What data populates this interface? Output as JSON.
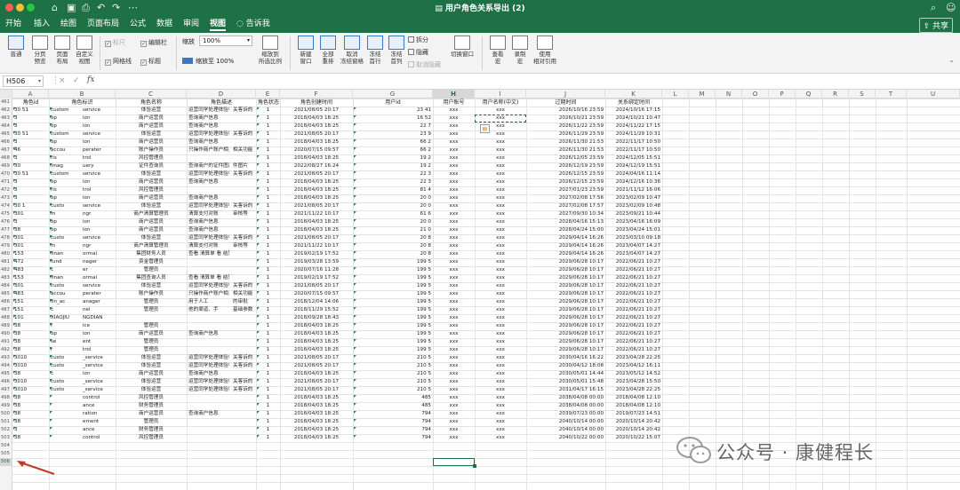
{
  "window": {
    "title": "用户角色关系导出 (2)",
    "controls": [
      "close",
      "minimize",
      "maximize"
    ],
    "quick_access": [
      "home-icon",
      "save-icon",
      "print-icon",
      "undo-icon",
      "redo-icon",
      "more-icon"
    ],
    "search_icon": "search-icon",
    "settings_icon": "profile-icon"
  },
  "tabs": [
    "开始",
    "插入",
    "绘图",
    "页面布局",
    "公式",
    "数据",
    "审阅",
    "视图",
    "告诉我"
  ],
  "active_tab": "视图",
  "share_label": "共享",
  "ribbon": {
    "view_buttons": [
      {
        "label": "普通",
        "icon": "normal-view-icon"
      },
      {
        "label": "分页\n预览",
        "icon": "page-break-icon"
      },
      {
        "label": "页面\n布局",
        "icon": "page-layout-icon"
      },
      {
        "label": "自定义\n视图",
        "icon": "custom-view-icon"
      }
    ],
    "checkboxes": [
      {
        "label": "标尺",
        "checked": true,
        "disabled": true
      },
      {
        "label": "编辑栏",
        "checked": true,
        "disabled": false
      },
      {
        "label": "网格线",
        "checked": true,
        "disabled": false
      },
      {
        "label": "标题",
        "checked": true,
        "disabled": false
      }
    ],
    "zoom_label": "缩放",
    "zoom_value": "100%",
    "zoom_100_label": "缩放至 100%",
    "zoom_selection_label": "缩放到\n所选比例",
    "window_buttons": [
      {
        "label": "新建\n窗口",
        "icon": "new-window-icon"
      },
      {
        "label": "全部\n重排",
        "icon": "arrange-all-icon"
      },
      {
        "label": "取消\n冻结窗格",
        "icon": "freeze-panes-icon"
      },
      {
        "label": "冻结\n首行",
        "icon": "freeze-row-icon"
      },
      {
        "label": "冻结\n首列",
        "icon": "freeze-col-icon"
      }
    ],
    "split_items": [
      {
        "label": "拆分",
        "disabled": false
      },
      {
        "label": "隐藏",
        "disabled": false
      },
      {
        "label": "取消隐藏",
        "disabled": true
      }
    ],
    "switch_window_label": "切换窗口",
    "macro_buttons": [
      {
        "label": "查看\n宏",
        "icon": "macro-view-icon"
      },
      {
        "label": "录制\n宏",
        "icon": "macro-record-icon"
      },
      {
        "label": "使用\n相对引用",
        "icon": "relative-ref-icon"
      }
    ]
  },
  "formula_bar": {
    "name_box": "H506",
    "cancel_icon": "×",
    "enter_icon": "✓",
    "fx": "fx",
    "value": ""
  },
  "columns": [
    "A",
    "B",
    "C",
    "D",
    "E",
    "F",
    "G",
    "H",
    "I",
    "J",
    "K",
    "L",
    "M",
    "N",
    "O",
    "P",
    "Q",
    "R",
    "S",
    "T",
    "U"
  ],
  "selected_column": "H",
  "header_row": {
    "number": "461",
    "cells": [
      "角色id",
      "角色标识",
      "角色名称",
      "角色描述",
      "角色状态",
      "角色创建时间",
      "用户id",
      "用户账号",
      "用户名称(中文)",
      "过期时间",
      "关系绑定时间"
    ]
  },
  "rows": [
    {
      "n": "462",
      "a": "30 51",
      "b": "custom",
      "b2": "service",
      "c": "体验运营",
      "d": "运营同学处理体验相关",
      "d2": "关客诉的",
      "e": "1",
      "f": "2021/08/05 20:17",
      "g": "23 41",
      "h": "xxx",
      "i": "xxx",
      "j": "2026/10/16 23:59",
      "k": "2024/10/16 17:15"
    },
    {
      "n": "463",
      "a": "3",
      "b": "op",
      "b2": "ion",
      "c": "商户运营员",
      "d": "查询商户信息",
      "d2": "",
      "e": "1",
      "f": "2018/04/03 18:25",
      "g": "16 52",
      "h": "xxx",
      "i": "xxx",
      "j": "2026/10/21 23:59",
      "k": "2024/10/21 10:47"
    },
    {
      "n": "464",
      "a": "3",
      "b": "op",
      "b2": "ion",
      "c": "商户运营员",
      "d": "查询商户信息",
      "d2": "",
      "e": "1",
      "f": "2018/04/03 18:25",
      "g": "22 7",
      "h": "xxx",
      "i": "xxx",
      "j": "2026/11/22 23:59",
      "k": "2024/11/22 17:15"
    },
    {
      "n": "465",
      "a": "30 51",
      "b": "custom",
      "b2": "service",
      "c": "体验运营",
      "d": "运营同学处理体验相关",
      "d2": "关客诉的",
      "e": "1",
      "f": "2021/08/05 20:17",
      "g": "23 9",
      "h": "xxx",
      "i": "xxx",
      "j": "2026/11/29 23:59",
      "k": "2024/11/29 10:31"
    },
    {
      "n": "466",
      "a": "3",
      "b": "op",
      "b2": "ion",
      "c": "商户运营员",
      "d": "查询商户信息",
      "d2": "",
      "e": "1",
      "f": "2018/04/03 18:25",
      "g": "66 2",
      "h": "xxx",
      "i": "xxx",
      "j": "2026/11/30 21:53",
      "k": "2022/11/17 10:50"
    },
    {
      "n": "467",
      "a": "46",
      "b": "accou",
      "b2": "perater",
      "c": "账户操作员",
      "d": "只操作商户账户相关功能",
      "d2": "相关功能",
      "e": "1",
      "f": "2020/07/15 09:57",
      "g": "66 2",
      "h": "xxx",
      "i": "xxx",
      "j": "2026/11/30 21:53",
      "k": "2022/11/17 10:50"
    },
    {
      "n": "468",
      "a": "3",
      "b": "ris",
      "b2": "trol",
      "c": "风控管理员",
      "d": "",
      "d2": "",
      "e": "1",
      "f": "2018/04/03 18:25",
      "g": "19 2",
      "h": "xxx",
      "i": "xxx",
      "j": "2026/12/05 23:59",
      "k": "2024/12/05 15:51"
    },
    {
      "n": "469",
      "a": "30",
      "b": "imag",
      "b2": "uery",
      "c": "证件查询员",
      "d": "查询商户的证件图片",
      "d2": "件图片",
      "e": "1",
      "f": "2022/08/27 16:24",
      "g": "19 2",
      "h": "xxx",
      "i": "xxx",
      "j": "2026/12/19 23:59",
      "k": "2024/12/19 15:51"
    },
    {
      "n": "470",
      "a": "30 51",
      "b": "custom",
      "b2": "service",
      "c": "体验运营",
      "d": "运营同学处理体验相关",
      "d2": "关客诉的",
      "e": "1",
      "f": "2021/08/05 20:17",
      "g": "22 3",
      "h": "xxx",
      "i": "xxx",
      "j": "2026/12/15 23:59",
      "k": "2024/04/16 11:14"
    },
    {
      "n": "471",
      "a": "3",
      "b": "op",
      "b2": "ion",
      "c": "商户运营员",
      "d": "查询商户信息",
      "d2": "",
      "e": "1",
      "f": "2018/04/03 18:25",
      "g": "22 3",
      "h": "xxx",
      "i": "xxx",
      "j": "2026/12/15 23:59",
      "k": "2024/12/16 10:36"
    },
    {
      "n": "472",
      "a": "3",
      "b": "ris",
      "b2": "trol",
      "c": "风控管理员",
      "d": "",
      "d2": "",
      "e": "1",
      "f": "2018/04/03 18:25",
      "g": "81 4",
      "h": "xxx",
      "i": "xxx",
      "j": "2027/01/23 23:59",
      "k": "2021/11/12 16:06"
    },
    {
      "n": "473",
      "a": "3",
      "b": "op",
      "b2": "ion",
      "c": "商户运营员",
      "d": "查询商户信息",
      "d2": "",
      "e": "1",
      "f": "2018/04/03 18:25",
      "g": "20 0",
      "h": "xxx",
      "i": "xxx",
      "j": "2027/02/08 17:56",
      "k": "2023/02/09 10:47"
    },
    {
      "n": "474",
      "a": "30 1",
      "b": "custo",
      "b2": "service",
      "c": "体验运营",
      "d": "运营同学处理体验相关",
      "d2": "关客诉的",
      "e": "1",
      "f": "2021/08/05 20:17",
      "g": "20 0",
      "h": "xxx",
      "i": "xxx",
      "j": "2027/02/08 17:57",
      "k": "2023/02/09 10:48"
    },
    {
      "n": "475",
      "a": "301",
      "b": "m",
      "b2": "ngr",
      "c": "商户清算管理员",
      "d": "清算支付对账",
      "d2": "审核等",
      "e": "1",
      "f": "2021/11/22 10:17",
      "g": "61 6",
      "h": "xxx",
      "i": "xxx",
      "j": "2027/09/30 10:34",
      "k": "2023/09/21 10:44"
    },
    {
      "n": "476",
      "a": "3",
      "b": "op",
      "b2": "ion",
      "c": "商户运营员",
      "d": "查询商户信息",
      "d2": "",
      "e": "1",
      "f": "2018/04/03 18:25",
      "g": "20 0",
      "h": "xxx",
      "i": "xxx",
      "j": "2028/04/16 15:13",
      "k": "2023/04/16 16:09"
    },
    {
      "n": "477",
      "a": "38",
      "b": "op",
      "b2": "ion",
      "c": "商户运营员",
      "d": "查询商户信息",
      "d2": "",
      "e": "1",
      "f": "2018/04/03 18:25",
      "g": "21 0",
      "h": "xxx",
      "i": "xxx",
      "j": "2028/04/24 15:00",
      "k": "2023/04/24 15:01"
    },
    {
      "n": "478",
      "a": "301",
      "b": "custo",
      "b2": "service",
      "c": "体验运营",
      "d": "运营同学处理体验相关",
      "d2": "关客诉的",
      "e": "1",
      "f": "2021/08/05 20:17",
      "g": "20 8",
      "h": "xxx",
      "i": "xxx",
      "j": "2029/04/14 16:26",
      "k": "2023/03/10 09:18"
    },
    {
      "n": "479",
      "a": "301",
      "b": "m",
      "b2": "ngr",
      "c": "商户清算管理员",
      "d": "清算支付对账",
      "d2": "审核等",
      "e": "1",
      "f": "2021/11/22 10:17",
      "g": "20 8",
      "h": "xxx",
      "i": "xxx",
      "j": "2029/04/14 16:26",
      "k": "2023/04/07 14:27"
    },
    {
      "n": "480",
      "a": "153",
      "b": "finan",
      "b2": "ormal",
      "c": "集团财务人员",
      "d": "查看 清算单 看 结算单",
      "d2": "",
      "e": "1",
      "f": "2019/02/19 17:52",
      "g": "20 8",
      "h": "xxx",
      "i": "xxx",
      "j": "2029/04/14 16:26",
      "k": "2023/04/07 14:27"
    },
    {
      "n": "481",
      "a": "472",
      "b": "fund",
      "b2": "nager",
      "c": "资金管理员",
      "d": "",
      "d2": "",
      "e": "1",
      "f": "2019/03/28 13:59",
      "g": "199 5",
      "h": "xxx",
      "i": "xxx",
      "j": "2029/06/28 10:17",
      "k": "2022/06/21 10:27"
    },
    {
      "n": "482",
      "a": "483",
      "b": "c",
      "b2": "er",
      "c": "管理员",
      "d": "",
      "d2": "",
      "e": "1",
      "f": "2020/07/16 11:28",
      "g": "199 5",
      "h": "xxx",
      "i": "xxx",
      "j": "2029/06/28 10:17",
      "k": "2022/06/21 10:27"
    },
    {
      "n": "483",
      "a": "153",
      "b": "finan",
      "b2": "ormal",
      "c": "集团查询人员",
      "d": "查看 清算单 看 结算单",
      "d2": "",
      "e": "1",
      "f": "2019/02/19 17:52",
      "g": "199 5",
      "h": "xxx",
      "i": "xxx",
      "j": "2029/06/28 10:17",
      "k": "2022/06/21 10:27"
    },
    {
      "n": "484",
      "a": "301",
      "b": "custo",
      "b2": "service",
      "c": "体验运营",
      "d": "运营同学处理体验相关",
      "d2": "关客诉的",
      "e": "1",
      "f": "2021/08/05 20:17",
      "g": "199 5",
      "h": "xxx",
      "i": "xxx",
      "j": "2029/06/28 10:17",
      "k": "2022/06/21 10:27"
    },
    {
      "n": "485",
      "a": "483",
      "b": "accou",
      "b2": "perater",
      "c": "账户操作员",
      "d": "只操作商户账户相关功能",
      "d2": "相关功能",
      "e": "1",
      "f": "2020/07/15 09:57",
      "g": "199 5",
      "h": "xxx",
      "i": "xxx",
      "j": "2029/06/28 10:17",
      "k": "2022/06/21 10:27"
    },
    {
      "n": "486",
      "a": "151",
      "b": "fin_ac",
      "b2": "anager",
      "c": "管理员",
      "d": "用于人工",
      "d2": "的审批",
      "e": "1",
      "f": "2018/12/04 14:06",
      "g": "199 5",
      "h": "xxx",
      "i": "xxx",
      "j": "2029/06/28 10:17",
      "k": "2022/06/21 10:27"
    },
    {
      "n": "487",
      "a": "151",
      "b": "c",
      "b2": "nel",
      "c": "管理员",
      "d": "他的渠道、手",
      "d2": "基础参数",
      "e": "1",
      "f": "2018/11/29 15:52",
      "g": "199 5",
      "h": "xxx",
      "i": "xxx",
      "j": "2029/06/28 10:17",
      "k": "2022/06/21 10:27"
    },
    {
      "n": "488",
      "a": "101",
      "b": "XIAOJIU",
      "b2": "NGDIAN",
      "c": "",
      "d": "",
      "d2": "",
      "e": "1",
      "f": "2018/09/28 18:43",
      "g": "199 5",
      "h": "xxx",
      "i": "xxx",
      "j": "2029/06/28 10:17",
      "k": "2022/06/21 10:27"
    },
    {
      "n": "489",
      "a": "38",
      "b": "f",
      "b2": "ice",
      "c": "管理员",
      "d": "",
      "d2": "",
      "e": "1",
      "f": "2018/04/03 18:25",
      "g": "199 5",
      "h": "xxx",
      "i": "xxx",
      "j": "2029/06/28 10:17",
      "k": "2022/06/21 10:27"
    },
    {
      "n": "490",
      "a": "38",
      "b": "op",
      "b2": "ion",
      "c": "商户运营员",
      "d": "查询商户信息",
      "d2": "",
      "e": "1",
      "f": "2018/04/03 18:25",
      "g": "199 5",
      "h": "xxx",
      "i": "xxx",
      "j": "2029/06/28 10:17",
      "k": "2022/06/21 10:27"
    },
    {
      "n": "491",
      "a": "38",
      "b": "se",
      "b2": "ent",
      "c": "管理员",
      "d": "",
      "d2": "",
      "e": "1",
      "f": "2018/04/03 18:25",
      "g": "199 5",
      "h": "xxx",
      "i": "xxx",
      "j": "2029/06/28 10:17",
      "k": "2022/06/21 10:27"
    },
    {
      "n": "492",
      "a": "38",
      "b": "r",
      "b2": "trol",
      "c": "管理员",
      "d": "",
      "d2": "",
      "e": "1",
      "f": "2018/04/03 18:25",
      "g": "199 5",
      "h": "xxx",
      "i": "xxx",
      "j": "2029/06/28 10:17",
      "k": "2022/06/21 10:27"
    },
    {
      "n": "493",
      "a": "3010",
      "b": "custo",
      "b2": "_service",
      "c": "体验运营",
      "d": "运营同学处理体验相关",
      "d2": "关客诉的",
      "e": "1",
      "f": "2021/08/05 20:17",
      "g": "210 5",
      "h": "xxx",
      "i": "xxx",
      "j": "2030/04/16 16:22",
      "k": "2023/04/28 22:25"
    },
    {
      "n": "494",
      "a": "3010",
      "b": "custo",
      "b2": "_service",
      "c": "体验运营",
      "d": "运营同学处理体验相关",
      "d2": "关客诉的",
      "e": "1",
      "f": "2021/08/05 20:17",
      "g": "210 5",
      "h": "xxx",
      "i": "xxx",
      "j": "2030/04/12 18:08",
      "k": "2023/04/12 16:11"
    },
    {
      "n": "495",
      "a": "38",
      "b": "c",
      "b2": "ion",
      "c": "商户运营员",
      "d": "查询商户信息",
      "d2": "",
      "e": "1",
      "f": "2018/04/03 18:25",
      "g": "210 5",
      "h": "xxx",
      "i": "xxx",
      "j": "2030/05/01 14:44",
      "k": "2023/05/12 14:52"
    },
    {
      "n": "496",
      "a": "3010",
      "b": "custo",
      "b2": "_service",
      "c": "体验运营",
      "d": "运营同学处理体验相关",
      "d2": "关客诉的",
      "e": "1",
      "f": "2021/08/05 20:17",
      "g": "210 5",
      "h": "xxx",
      "i": "xxx",
      "j": "2030/05/01 15:48",
      "k": "2023/04/28 15:50"
    },
    {
      "n": "497",
      "a": "3010",
      "b": "custo",
      "b2": "_service",
      "c": "体验运营",
      "d": "运营同学处理体验相关",
      "d2": "关客诉的",
      "e": "1",
      "f": "2021/08/05 20:17",
      "g": "210 5",
      "h": "xxx",
      "i": "xxx",
      "j": "2031/04/17 16:15",
      "k": "2023/04/28 22:25"
    },
    {
      "n": "498",
      "a": "38",
      "b": "",
      "b2": "control",
      "c": "风控管理员",
      "d": "",
      "d2": "",
      "e": "1",
      "f": "2018/04/03 18:25",
      "g": "485",
      "h": "xxx",
      "i": "xxx",
      "j": "2038/04/08 00:00",
      "k": "2018/04/08 12:10"
    },
    {
      "n": "499",
      "a": "38",
      "b": "",
      "b2": "ance",
      "c": "财务管理员",
      "d": "",
      "d2": "",
      "e": "1",
      "f": "2018/04/03 18:25",
      "g": "485",
      "h": "xxx",
      "i": "xxx",
      "j": "2038/04/08 00:00",
      "k": "2018/04/08 12:10"
    },
    {
      "n": "500",
      "a": "38",
      "b": "",
      "b2": "ration",
      "c": "商户运营员",
      "d": "查询商户信息",
      "d2": "",
      "e": "1",
      "f": "2018/04/03 18:25",
      "g": "794",
      "h": "xxx",
      "i": "xxx",
      "j": "2039/07/23 00:00",
      "k": "2019/07/23 14:51"
    },
    {
      "n": "501",
      "a": "38",
      "b": "",
      "b2": "ement",
      "c": "管理员",
      "d": "",
      "d2": "",
      "e": "1",
      "f": "2018/04/03 18:25",
      "g": "794",
      "h": "xxx",
      "i": "xxx",
      "j": "2040/10/14 00:00",
      "k": "2020/10/14 20:42"
    },
    {
      "n": "502",
      "a": "3",
      "b": "",
      "b2": "ance",
      "c": "财务管理员",
      "d": "",
      "d2": "",
      "e": "1",
      "f": "2018/04/03 18:25",
      "g": "794",
      "h": "xxx",
      "i": "xxx",
      "j": "2040/10/14 00:00",
      "k": "2020/10/14 20:42"
    },
    {
      "n": "503",
      "a": "38",
      "b": "",
      "b2": "control",
      "c": "风控管理员",
      "d": "",
      "d2": "",
      "e": "1",
      "f": "2018/04/03 18:25",
      "g": "794",
      "h": "xxx",
      "i": "xxx",
      "j": "2040/10/22 00:00",
      "k": "2020/10/22 15:07"
    }
  ],
  "empty_rows": [
    "504",
    "505",
    "506"
  ],
  "selected_row": "506",
  "watermark": "公众号 · 康健程长",
  "colors": {
    "accent": "#1e7145",
    "annotation_arrow": "#c0392b"
  }
}
